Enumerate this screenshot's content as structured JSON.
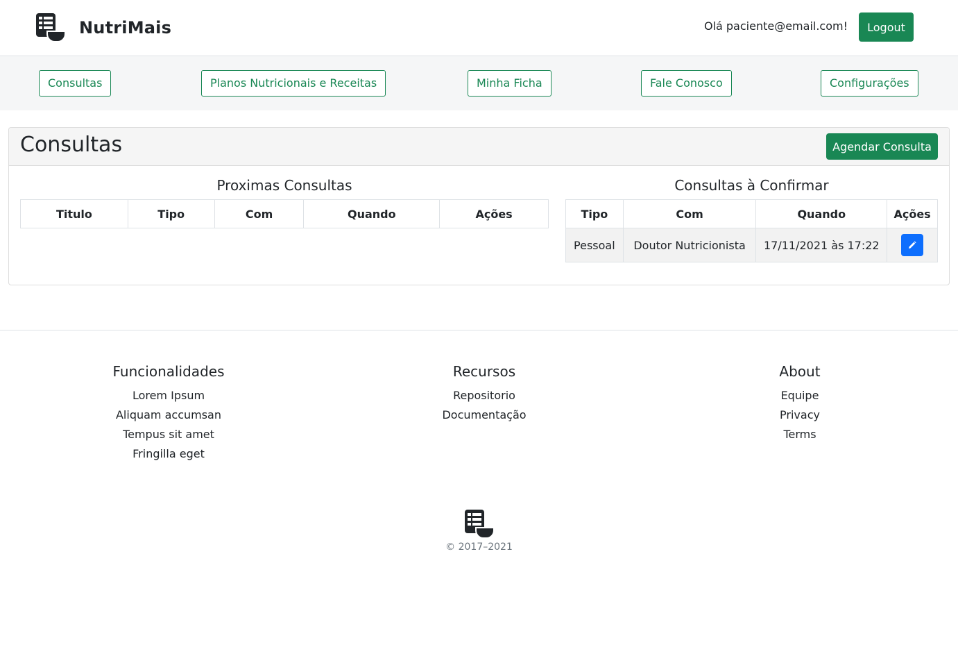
{
  "header": {
    "brand_name": "NutriMais",
    "greeting": "Olá paciente@email.com!",
    "logout_label": "Logout"
  },
  "nav": {
    "items": [
      {
        "label": "Consultas"
      },
      {
        "label": "Planos Nutricionais e Receitas"
      },
      {
        "label": "Minha Ficha"
      },
      {
        "label": "Fale Conosco"
      },
      {
        "label": "Configurações"
      }
    ]
  },
  "main": {
    "title": "Consultas",
    "schedule_button": "Agendar Consulta",
    "upcoming": {
      "title": "Proximas Consultas",
      "columns": [
        "Titulo",
        "Tipo",
        "Com",
        "Quando",
        "Ações"
      ],
      "rows": []
    },
    "pending": {
      "title": "Consultas à Confirmar",
      "columns": [
        "Tipo",
        "Com",
        "Quando",
        "Ações"
      ],
      "rows": [
        {
          "tipo": "Pessoal",
          "com": "Doutor Nutricionista",
          "quando": "17/11/2021 às 17:22",
          "action_icon": "pencil-icon"
        }
      ]
    }
  },
  "footer": {
    "columns": [
      {
        "title": "Funcionalidades",
        "links": [
          "Lorem Ipsum",
          "Aliquam accumsan",
          "Tempus sit amet",
          "Fringilla eget"
        ]
      },
      {
        "title": "Recursos",
        "links": [
          "Repositorio",
          "Documentação"
        ]
      },
      {
        "title": "About",
        "links": [
          "Equipe",
          "Privacy",
          "Terms"
        ]
      }
    ],
    "copyright": "© 2017–2021"
  },
  "colors": {
    "primary_green": "#198754",
    "edit_blue": "#0d6efd",
    "nav_bg": "#f5f6f7"
  }
}
